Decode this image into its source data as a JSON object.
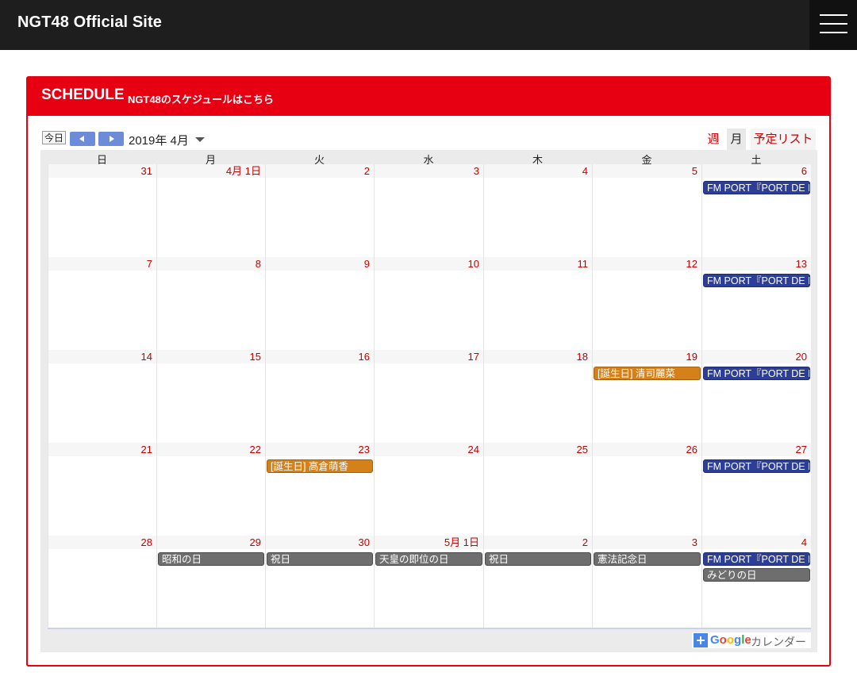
{
  "header": {
    "site_title": "NGT48 Official Site",
    "menu_icon": "hamburger-menu-icon"
  },
  "panel": {
    "title": "SCHEDULE",
    "subtitle": "NGT48のスケジュールはこちら"
  },
  "calendar": {
    "today_label": "今日",
    "month_label": "2019年 4月",
    "views": {
      "week": "週",
      "month": "月",
      "list": "予定リスト",
      "selected": "月"
    },
    "weekdays": [
      "日",
      "月",
      "火",
      "水",
      "木",
      "金",
      "土"
    ],
    "weeks": [
      {
        "days": [
          "31",
          "4月 1日",
          "2",
          "3",
          "4",
          "5",
          "6"
        ]
      },
      {
        "days": [
          "7",
          "8",
          "9",
          "10",
          "11",
          "12",
          "13"
        ]
      },
      {
        "days": [
          "14",
          "15",
          "16",
          "17",
          "18",
          "19",
          "20"
        ]
      },
      {
        "days": [
          "21",
          "22",
          "23",
          "24",
          "25",
          "26",
          "27"
        ]
      },
      {
        "days": [
          "28",
          "29",
          "30",
          "5月 1日",
          "2",
          "3",
          "4"
        ]
      }
    ],
    "events": [
      {
        "week": 0,
        "day": 6,
        "slot": 0,
        "label": "FM PORT『PORT DE NGT』",
        "color": "#2c3e96"
      },
      {
        "week": 1,
        "day": 6,
        "slot": 0,
        "label": "FM PORT『PORT DE NGT』",
        "color": "#2c3e96"
      },
      {
        "week": 2,
        "day": 5,
        "slot": 0,
        "label": "[誕生日] 清司麗菜",
        "color": "#d5811a"
      },
      {
        "week": 2,
        "day": 6,
        "slot": 0,
        "label": "FM PORT『PORT DE NGT』",
        "color": "#2c3e96"
      },
      {
        "week": 3,
        "day": 2,
        "slot": 0,
        "label": "[誕生日] 高倉萌香",
        "color": "#d5811a"
      },
      {
        "week": 3,
        "day": 6,
        "slot": 0,
        "label": "FM PORT『PORT DE NGT』",
        "color": "#2c3e96"
      },
      {
        "week": 4,
        "day": 1,
        "slot": 0,
        "label": "昭和の日",
        "color": "#6e6e6e"
      },
      {
        "week": 4,
        "day": 2,
        "slot": 0,
        "label": "祝日",
        "color": "#6e6e6e"
      },
      {
        "week": 4,
        "day": 3,
        "slot": 0,
        "label": "天皇の即位の日",
        "color": "#6e6e6e"
      },
      {
        "week": 4,
        "day": 4,
        "slot": 0,
        "label": "祝日",
        "color": "#6e6e6e"
      },
      {
        "week": 4,
        "day": 5,
        "slot": 0,
        "label": "憲法記念日",
        "color": "#6e6e6e"
      },
      {
        "week": 4,
        "day": 6,
        "slot": 0,
        "label": "FM PORT『PORT DE NGT』",
        "color": "#2c3e96"
      },
      {
        "week": 4,
        "day": 6,
        "slot": 1,
        "label": "みどりの日",
        "color": "#6e6e6e"
      }
    ],
    "google_badge": {
      "google": "Google",
      "calendar": "カレンダー"
    }
  },
  "colors": {
    "brand_red": "#e60012",
    "topbar": "#1e1e1e",
    "nav_blue": "#6c8bd9",
    "date_red": "#c40000"
  }
}
